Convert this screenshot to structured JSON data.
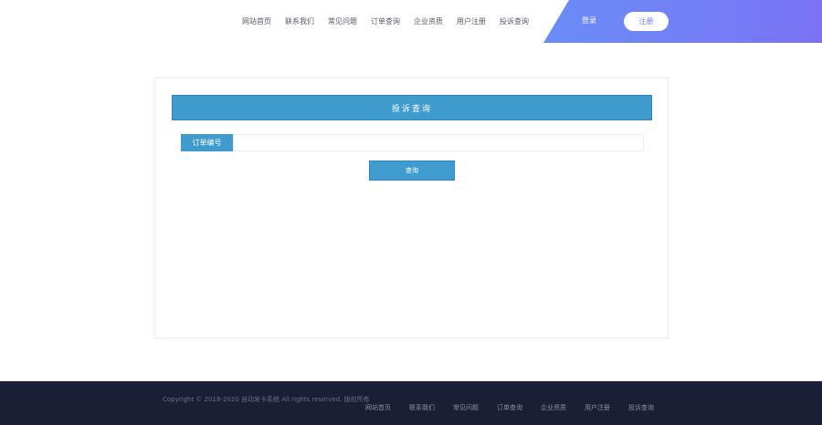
{
  "header": {
    "nav": [
      "网站首页",
      "联系我们",
      "常见问题",
      "订单查询",
      "企业资质",
      "用户注册",
      "投诉查询"
    ],
    "login_label": "登录",
    "register_label": "注册",
    "gradient_colors": [
      "#6a8df7",
      "#7a73f5"
    ]
  },
  "main": {
    "panel_title": "投诉查询",
    "order_label": "订单编号",
    "order_value": "",
    "query_label": "查询",
    "accent_color": "#409ccf"
  },
  "footer": {
    "copyright": "Copyright © 2018-2020 自动发卡系统 All rights reserved. 版权所有",
    "nav": [
      "网站首页",
      "联系我们",
      "常见问题",
      "订单查询",
      "企业资质",
      "用户注册",
      "投诉查询"
    ],
    "background_color": "#1a1f36"
  }
}
